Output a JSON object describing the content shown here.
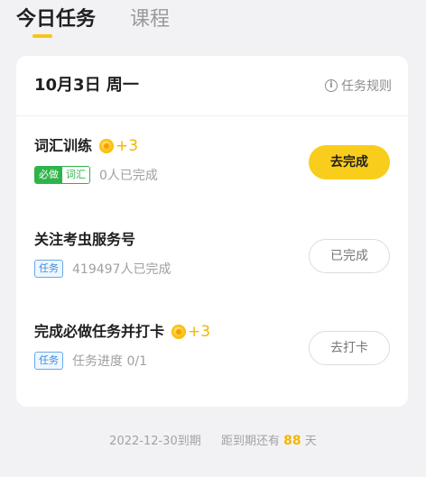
{
  "tabs": [
    {
      "label": "今日任务",
      "active": true
    },
    {
      "label": "课程",
      "active": false
    }
  ],
  "card": {
    "date_title": "10月3日 周一",
    "rules_label": "任务规则"
  },
  "tasks": [
    {
      "title": "词汇训练",
      "reward": "+3",
      "badge_required": "必做",
      "badge_type": "词汇",
      "status_text": "0人已完成",
      "action_label": "去完成"
    },
    {
      "title": "关注考虫服务号",
      "badge_type": "任务",
      "status_text": "419497人已完成",
      "action_label": "已完成"
    },
    {
      "title": "完成必做任务并打卡",
      "reward": "+3",
      "badge_type": "任务",
      "status_text": "任务进度 0/1",
      "action_label": "去打卡"
    }
  ],
  "footer": {
    "expire_text": "2022-12-30到期",
    "remaining_prefix": "距到期还有",
    "remaining_days": "88",
    "remaining_suffix": "天"
  },
  "colors": {
    "accent_yellow": "#f9cd1b",
    "coin_yellow": "#f5b400",
    "required_green": "#2fb34a",
    "task_blue": "#3b8ddb"
  }
}
